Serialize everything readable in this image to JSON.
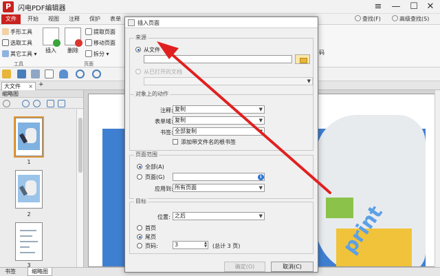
{
  "app": {
    "logo_letter": "P",
    "title": "闪电PDF编辑器"
  },
  "window_controls": {
    "menu": "≡",
    "minimize": "—",
    "maximize": "☐",
    "close": "✕"
  },
  "menu": {
    "tabs": [
      "文件",
      "开始",
      "视图",
      "注释",
      "保护",
      "表单"
    ],
    "right_tools": [
      "查找(F)",
      "高级查找(S)"
    ]
  },
  "ribbon": {
    "tools": [
      "手形工具",
      "选取工具",
      "其它工具"
    ],
    "tools_group_label": "工具",
    "insert_label": "插入",
    "delete_label": "删除",
    "page_items": [
      "提取页面",
      "移动页面",
      "拆分"
    ],
    "pages_group_label": "页面",
    "right_edge_label": "码"
  },
  "doc_tab": {
    "label": "大文件",
    "close": "×",
    "add": "+"
  },
  "left_panel": {
    "header": "缩略图",
    "thumbnails": [
      {
        "number": "1"
      },
      {
        "number": "2"
      },
      {
        "number": "3"
      }
    ]
  },
  "bottom_tabs": [
    "书签",
    "缩略图"
  ],
  "page_art_text": "print",
  "dialog": {
    "title": "插入页面",
    "source": {
      "legend": "来源",
      "from_file": "从文件",
      "from_file_value": "",
      "from_open": "从已打开的文档",
      "from_open_value": ""
    },
    "objects": {
      "legend": "对象上的动作",
      "comments_label": "注释:",
      "comments_value": "复制",
      "forms_label": "表单域:",
      "forms_value": "复制",
      "bookmarks_label": "书签:",
      "bookmarks_value": "全部复制",
      "add_bookmark_label": "添加带文件名的根书签"
    },
    "range": {
      "legend": "页面范围",
      "all_label": "全部(A)",
      "pages_label": "页面(G)",
      "pages_value": "",
      "apply_label": "应用到:",
      "apply_value": "所有页面"
    },
    "target": {
      "legend": "目标",
      "position_label": "位置:",
      "position_value": "之后",
      "first_label": "首页",
      "last_label": "尾页",
      "pagenum_label": "页码:",
      "pagenum_value": "3",
      "total_label": "(总计 3 页)"
    },
    "ok_label": "确定(O)",
    "cancel_label": "取消(C)"
  },
  "colors": {
    "accent": "#c9211e",
    "annotation_arrow": "#e02020",
    "page_blue": "#3f7fd1"
  }
}
